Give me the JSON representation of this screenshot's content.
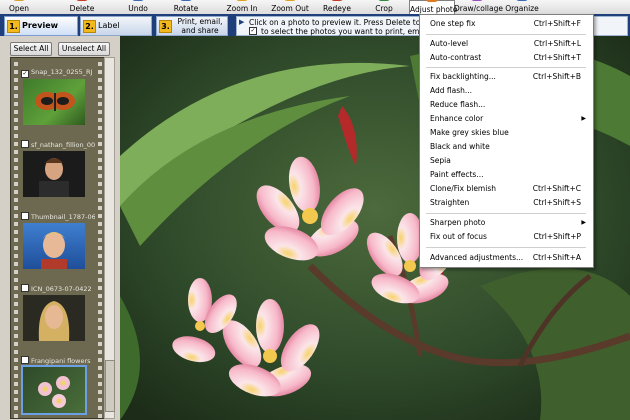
{
  "toolbar": {
    "items": [
      {
        "label": "Open",
        "icon": "open-icon",
        "color": "#d8a232"
      },
      {
        "label": "Delete",
        "icon": "delete-icon",
        "color": "#c23b22"
      },
      {
        "label": "Undo",
        "icon": "undo-icon",
        "color": "#3a68b5"
      },
      {
        "label": "Rotate",
        "icon": "rotate-icon",
        "color": "#3a68b5"
      },
      {
        "label": "Zoom In",
        "icon": "zoom-in-icon",
        "color": "#e0a020"
      },
      {
        "label": "Zoom Out",
        "icon": "zoom-out-icon",
        "color": "#e0a020"
      },
      {
        "label": "Redeye",
        "icon": "redeye-icon",
        "color": "#c23b22"
      },
      {
        "label": "Crop",
        "icon": "crop-icon",
        "color": "#2f8a3b"
      },
      {
        "label": "Adjust photo",
        "icon": "adjust-photo-icon",
        "color": "#e07a20"
      },
      {
        "label": "Draw/collage",
        "icon": "draw-collage-icon",
        "color": "#9a4fbf"
      },
      {
        "label": "Organize",
        "icon": "organize-icon",
        "color": "#3a68b5"
      }
    ]
  },
  "steps": {
    "step1": {
      "num": "1.",
      "label": "Preview"
    },
    "step2": {
      "num": "2.",
      "label": "Label"
    },
    "step3": {
      "num": "3.",
      "label": "Print, email, and share"
    },
    "hint_line1": "Click on a photo to preview it.  Press Delete to del",
    "hint_line2": "to select the photos you want to print, email,"
  },
  "left": {
    "select_all": "Select All",
    "unselect_all": "Unselect All",
    "thumbnails": [
      {
        "caption": "Snap_132_0255_RJ",
        "checked": true
      },
      {
        "caption": "sf_nathan_fillion_001",
        "checked": false
      },
      {
        "caption": "Thumbnail_1787-06-0",
        "checked": false
      },
      {
        "caption": "ICN_0673-07-0422",
        "checked": false
      },
      {
        "caption": "Frangipani flowers",
        "checked": false
      }
    ]
  },
  "menu": {
    "items": [
      {
        "label": "One step fix",
        "shortcut": "Ctrl+Shift+F"
      },
      {
        "label": "Auto-level",
        "shortcut": "Ctrl+Shift+L"
      },
      {
        "label": "Auto-contrast",
        "shortcut": "Ctrl+Shift+T"
      },
      {
        "label": "Fix backlighting...",
        "shortcut": "Ctrl+Shift+B"
      },
      {
        "label": "Add flash...",
        "shortcut": ""
      },
      {
        "label": "Reduce flash...",
        "shortcut": ""
      },
      {
        "label": "Enhance color",
        "shortcut": ""
      },
      {
        "label": "Make grey skies blue",
        "shortcut": ""
      },
      {
        "label": "Black and white",
        "shortcut": ""
      },
      {
        "label": "Sepia",
        "shortcut": ""
      },
      {
        "label": "Paint effects...",
        "shortcut": ""
      },
      {
        "label": "Clone/Fix blemish",
        "shortcut": "Ctrl+Shift+C"
      },
      {
        "label": "Straighten",
        "shortcut": "Ctrl+Shift+S"
      },
      {
        "label": "Sharpen photo",
        "shortcut": ""
      },
      {
        "label": "Fix out of focus",
        "shortcut": "Ctrl+Shift+P"
      },
      {
        "label": "Advanced adjustments...",
        "shortcut": "Ctrl+Shift+A"
      }
    ]
  },
  "colors": {
    "steps_bar": "#1f3f7a",
    "step_number": "#f3b81d",
    "film_strip": "#6d6850"
  }
}
